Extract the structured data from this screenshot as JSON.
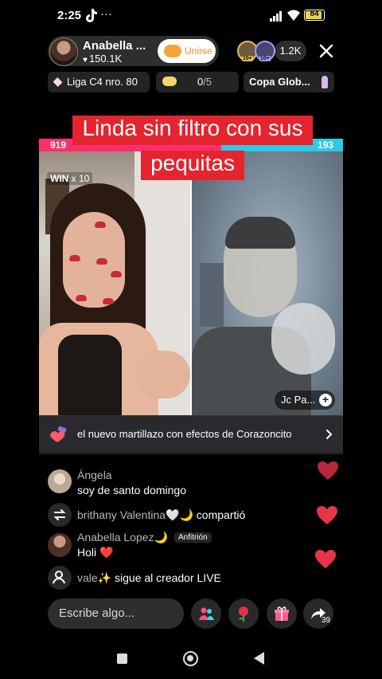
{
  "status_bar": {
    "time": "2:25",
    "dots": "···",
    "battery": "84"
  },
  "host": {
    "name": "Anabella ...",
    "likes": "150.1K",
    "join_label": "Unirse"
  },
  "viewers": {
    "badges": [
      "10+",
      "10+"
    ],
    "count": "1.2K"
  },
  "chips": {
    "league": "Liga C4 nro. 80",
    "points_value": "0",
    "points_total": "/5",
    "cup": "Copa Glob..."
  },
  "caption": "Linda sin filtro con sus pequitas",
  "battle": {
    "score_left": "919",
    "score_right": "193",
    "left_score_fraction": 0.6,
    "win_label": "WIN",
    "win_multiplier": "x 10",
    "guest_name": "Jc Pa...",
    "banner_text": "el nuevo martillazo con efectos de Corazoncito"
  },
  "comments": [
    {
      "name": "Ángela",
      "text": "soy de santo domingo"
    },
    {
      "name": "brithany Valentina🤍🌙",
      "action": "compartió"
    },
    {
      "name": "Anabella Lopez🌙",
      "badge": "Anfitrión",
      "text": "Holi ❤️"
    },
    {
      "name": "vale✨",
      "action": "sigue al creador LIVE"
    }
  ],
  "input": {
    "placeholder": "Escribe algo..."
  },
  "share": {
    "count": "39"
  },
  "colors": {
    "accent_red": "#e4242e",
    "score_pink": "#ff2f6f",
    "score_cyan": "#2ec9e6",
    "heart": "#e8334a"
  },
  "icons": [
    "tiktok-icon",
    "signal-icon",
    "wifi-icon",
    "battery-icon",
    "close-icon",
    "diamond-icon",
    "cloud-icon",
    "trophy-figure-icon",
    "plus-icon",
    "hammer-gift-icon",
    "chevron-right-icon",
    "repost-icon",
    "person-icon",
    "heart-icon",
    "people-icon",
    "rose-icon",
    "gift-icon",
    "share-icon"
  ]
}
